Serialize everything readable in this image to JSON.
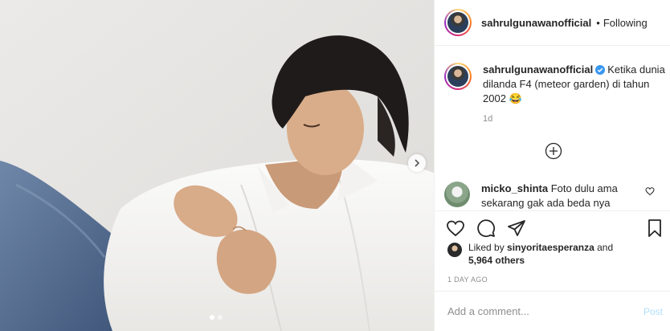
{
  "post": {
    "image_alt": "Young man in white shirt and jeans leaning back, buttoning his shirt",
    "carousel_dots": 2,
    "carousel_active": 1
  },
  "header": {
    "username": "sahrulgunawanofficial",
    "separator": "•",
    "follow_state": "Following"
  },
  "caption": {
    "username": "sahrulgunawanofficial",
    "text": "Ketika dunia dilanda F4 (meteor garden) di tahun 2002 😂",
    "time": "1d"
  },
  "comments": [
    {
      "username": "micko_shinta",
      "text": "Foto dulu ama sekarang gak ada beda nya"
    }
  ],
  "likes": {
    "prefix": "Liked by",
    "user": "sinyoritaesperanza",
    "joiner": "and",
    "others": "5,964 others"
  },
  "date": "1 DAY AGO",
  "composer": {
    "placeholder": "Add a comment...",
    "post_label": "Post"
  },
  "icons": {
    "like": "heart-icon",
    "comment": "comment-icon",
    "share": "share-icon",
    "save": "bookmark-icon",
    "load_more": "plus-circle-icon",
    "verified": "verified-badge-icon",
    "next": "chevron-right-icon"
  },
  "colors": {
    "verified": "#3897f0",
    "post_disabled": "#b2dffc",
    "muted": "#8e8e8e",
    "text": "#262626"
  }
}
